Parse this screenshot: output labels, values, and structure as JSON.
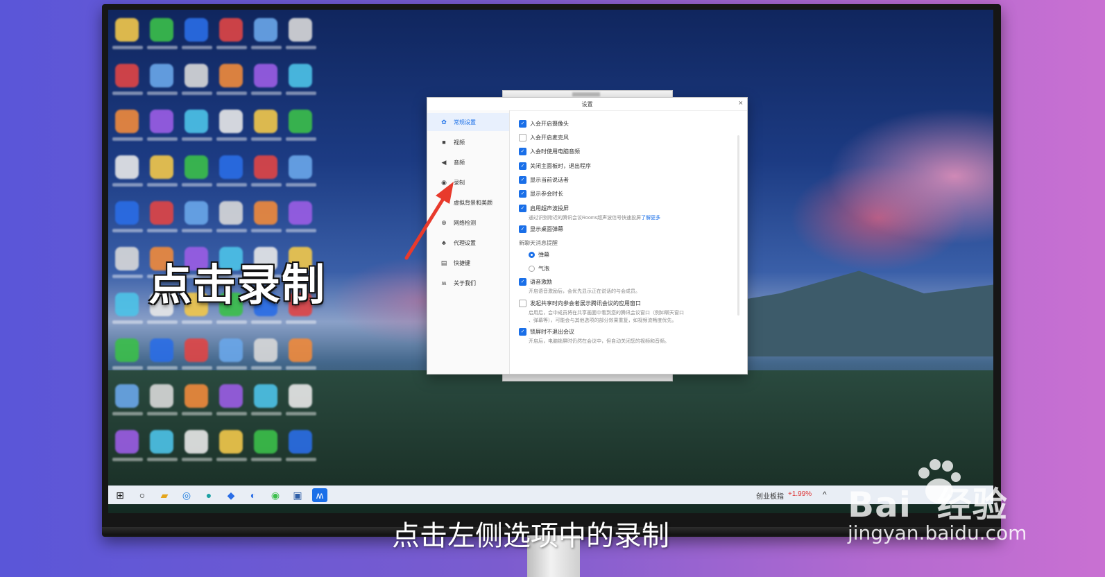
{
  "overlay": {
    "caption_main": "点击录制",
    "caption_sub": "点击左侧选项中的录制"
  },
  "watermark": {
    "brand": "Bai  经验",
    "url": "jingyan.baidu.com"
  },
  "dialog": {
    "title": "设置",
    "close_icon": "×",
    "nav": [
      {
        "label": "常规设置",
        "icon": "gear-icon",
        "glyph": "✿",
        "active": true
      },
      {
        "label": "视频",
        "icon": "camera-icon",
        "glyph": "■",
        "active": false
      },
      {
        "label": "音频",
        "icon": "speaker-icon",
        "glyph": "◀",
        "active": false
      },
      {
        "label": "录制",
        "icon": "record-icon",
        "glyph": "◉",
        "active": false
      },
      {
        "label": "虚拟背景和美颜",
        "icon": "background-icon",
        "glyph": "",
        "active": false
      },
      {
        "label": "网络检测",
        "icon": "globe-icon",
        "glyph": "⊕",
        "active": false
      },
      {
        "label": "代理设置",
        "icon": "proxy-icon",
        "glyph": "♣",
        "active": false
      },
      {
        "label": "快捷键",
        "icon": "keyboard-icon",
        "glyph": "▤",
        "active": false
      },
      {
        "label": "关于我们",
        "icon": "logo-icon",
        "glyph": "ʍ",
        "active": false
      }
    ],
    "options": [
      {
        "label": "入会开启摄像头",
        "checked": true
      },
      {
        "label": "入会开启麦克风",
        "checked": false
      },
      {
        "label": "入会时使用电脑音频",
        "checked": true
      },
      {
        "label": "关闭主面板时，退出程序",
        "checked": true
      },
      {
        "label": "显示当前说话者",
        "checked": true
      },
      {
        "label": "显示参会时长",
        "checked": true
      },
      {
        "label": "启用超声波投屏",
        "checked": true
      },
      {
        "label": "显示桌面弹幕",
        "checked": true
      }
    ],
    "ultrasonic_desc": "通过识别附近的腾讯会议Rooms超声波信号快速投屏",
    "learn_more": "了解更多",
    "new_msg_section": "新聊天消息提醒",
    "radio_options": [
      {
        "label": "弹幕",
        "selected": true
      },
      {
        "label": "气泡",
        "selected": false
      }
    ],
    "voice_excite": {
      "label": "语音激励",
      "checked": true,
      "desc": "开启语音激励后，会优先显示正在说话的与会成员。"
    },
    "share_app_window": {
      "label": "发起共享时向参会者展示腾讯会议的应用窗口",
      "checked": false,
      "desc1": "启用后，会中成员将在共享画面中看到您的腾讯会议窗口（例如聊天窗口",
      "desc2": "、弹幕等），可能会与其他选项的部分效果重复，如视频流畅度优先。"
    },
    "lock_screen": {
      "label": "锁屏时不退出会议",
      "checked": true,
      "desc": "开启后，电脑锁屏时仍然在会议中，但自动关闭您的视频和音频。"
    }
  },
  "taskbar": {
    "stock_label": "创业板指",
    "stock_value": "+1.99%",
    "tray": "^"
  },
  "colors": {
    "accent": "#1a6fe8",
    "arrow": "#e83a2c"
  }
}
